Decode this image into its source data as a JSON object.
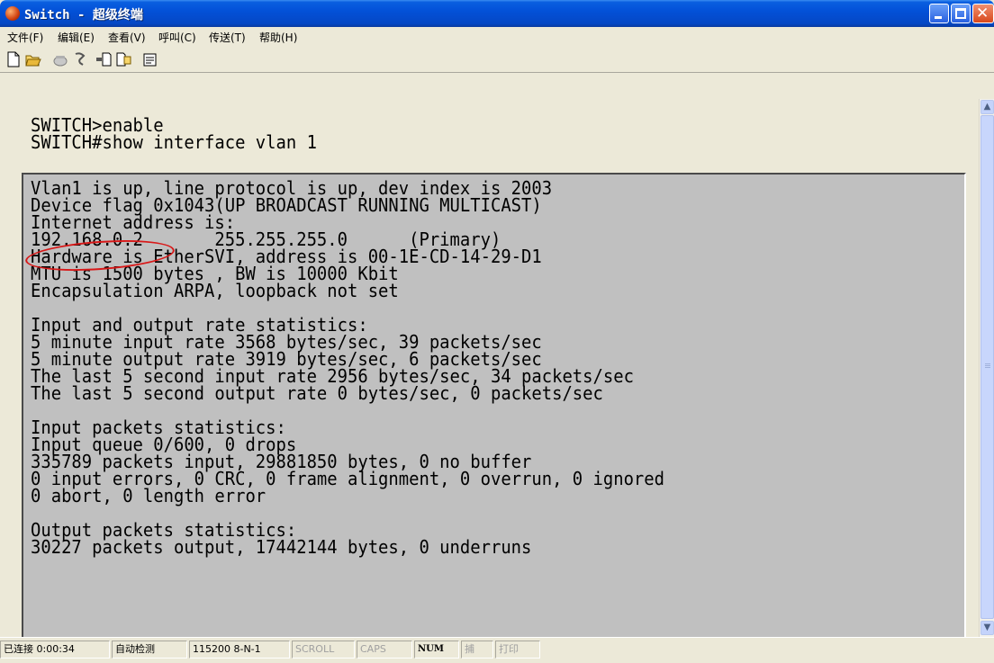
{
  "window": {
    "title": "Switch - 超级终端"
  },
  "menu": [
    "文件(F)",
    "编辑(E)",
    "查看(V)",
    "呼叫(C)",
    "传送(T)",
    "帮助(H)"
  ],
  "toolbar": {
    "icons": [
      "new-document-icon",
      "open-folder-icon",
      "call-icon",
      "disconnect-icon",
      "send-icon",
      "receive-icon",
      "properties-icon"
    ]
  },
  "terminal": {
    "commands": [
      "SWITCH>enable",
      "SWITCH#show interface vlan 1"
    ],
    "output_lines": [
      "Vlan1 is up, line protocol is up, dev index is 2003",
      "Device flag 0x1043(UP BROADCAST RUNNING MULTICAST)",
      "Internet address is:",
      "192.168.0.2       255.255.255.0      (Primary)",
      "Hardware is EtherSVI, address is 00-1E-CD-14-29-D1",
      "MTU is 1500 bytes , BW is 10000 Kbit",
      "Encapsulation ARPA, loopback not set",
      "",
      "Input and output rate statistics:",
      "5 minute input rate 3568 bytes/sec, 39 packets/sec",
      "5 minute output rate 3919 bytes/sec, 6 packets/sec",
      "The last 5 second input rate 2956 bytes/sec, 34 packets/sec",
      "The last 5 second output rate 0 bytes/sec, 0 packets/sec",
      "",
      "Input packets statistics:",
      "Input queue 0/600, 0 drops",
      "335789 packets input, 29881850 bytes, 0 no buffer",
      "0 input errors, 0 CRC, 0 frame alignment, 0 overrun, 0 ignored",
      "0 abort, 0 length error",
      "",
      "Output packets statistics:",
      "30227 packets output, 17442144 bytes, 0 underruns"
    ],
    "highlight_color": "#d81818"
  },
  "status": {
    "connection": "已连接 0:00:34",
    "detect": "自动检测",
    "baud": "115200 8-N-1",
    "scroll": "SCROLL",
    "caps": "CAPS",
    "num": "NUM",
    "capture": "捕",
    "print": "打印"
  },
  "colors": {
    "titlebar": "#0351d8",
    "terminal_bg": "#c0c0c0",
    "chrome": "#ece9d8"
  }
}
